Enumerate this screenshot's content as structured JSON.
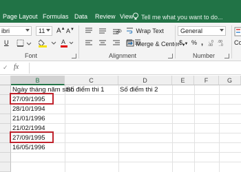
{
  "tabs": [
    "Page Layout",
    "Formulas",
    "Data",
    "Review",
    "View"
  ],
  "tell_me": "Tell me what you want to do...",
  "font": {
    "name": "ibri",
    "size": "11",
    "group_label": "Font"
  },
  "alignment": {
    "wrap_text": "Wrap Text",
    "merge_center": "Merge & Center",
    "group_label": "Alignment"
  },
  "number": {
    "format": "General",
    "currency_symbol": "$",
    "percent_symbol": "%",
    "comma_symbol": ",",
    "group_label": "Number"
  },
  "conditional_fragment": "Co",
  "formula_bar": {
    "check_symbol": "✓",
    "fx_symbol": "fx"
  },
  "columns": [
    "B",
    "C",
    "D",
    "E",
    "F",
    "G"
  ],
  "cells": {
    "b_header": "Ngày tháng năm sinh",
    "c_header": "Số điểm thi 1",
    "d_header": "Số điểm thi 2",
    "dates": [
      "27/09/1995",
      "28/10/1994",
      "21/01/1996",
      "21/02/1994",
      "27/09/1995",
      "16/05/1996"
    ]
  },
  "colors": {
    "ribbon_green": "#217346",
    "highlight_red": "#c0222c"
  }
}
